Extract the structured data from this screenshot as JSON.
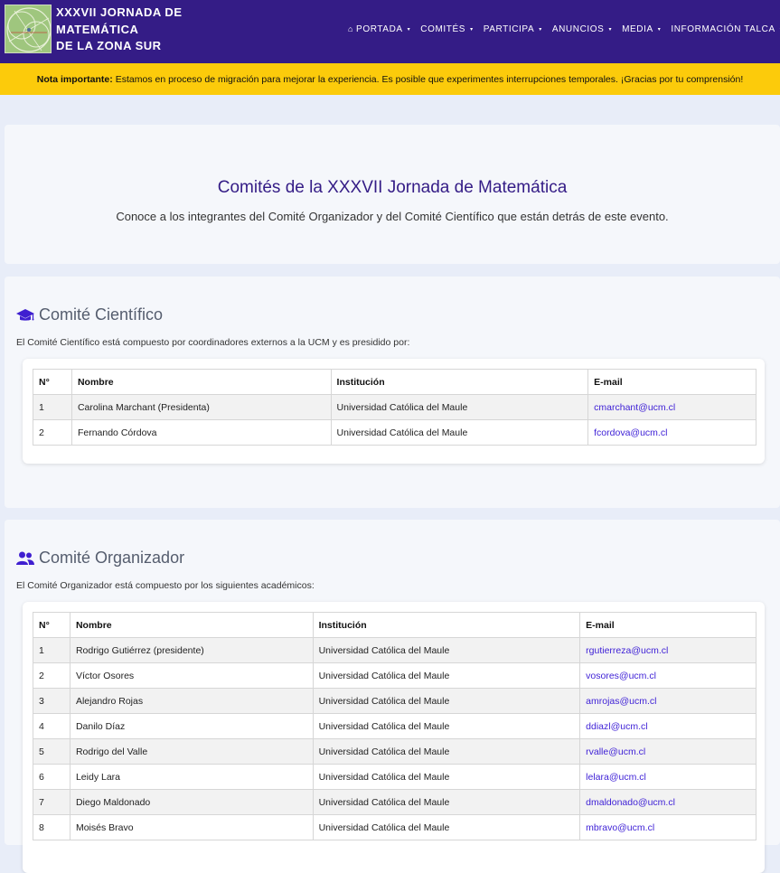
{
  "header": {
    "brand_line1": "XXXVII JORNADA DE",
    "brand_line2": "MATEMÁTICA",
    "brand_line3": "DE LA ZONA SUR",
    "nav": [
      "PORTADA",
      "COMITÉS",
      "PARTICIPA",
      "ANUNCIOS",
      "MEDIA",
      "INFORMACIÓN TALCA"
    ]
  },
  "notice": {
    "label": "Nota importante:",
    "text": "Estamos en proceso de migración para mejorar la experiencia. Es posible que experimentes interrupciones temporales. ¡Gracias por tu comprensión!"
  },
  "hero": {
    "title": "Comités de la XXXVII Jornada de Matemática",
    "subtitle": "Conoce a los integrantes del Comité Organizador y del Comité Científico que están detrás de este evento."
  },
  "cientifico": {
    "title": "Comité Científico",
    "description": "El Comité Científico está compuesto por coordinadores externos a la UCM y es presidido por:",
    "headers": [
      "N°",
      "Nombre",
      "Institución",
      "E-mail"
    ],
    "rows": [
      [
        "1",
        "Carolina Marchant (Presidenta)",
        "Universidad Católica del Maule",
        "cmarchant@ucm.cl"
      ],
      [
        "2",
        "Fernando Córdova",
        "Universidad Católica del Maule",
        "fcordova@ucm.cl"
      ]
    ]
  },
  "organizador": {
    "title": "Comité Organizador",
    "description": "El Comité Organizador está compuesto por los siguientes académicos:",
    "headers": [
      "N°",
      "Nombre",
      "Institución",
      "E-mail"
    ],
    "rows": [
      [
        "1",
        "Rodrigo Gutiérrez (presidente)",
        "Universidad Católica del Maule",
        "rgutierreza@ucm.cl"
      ],
      [
        "2",
        "Víctor Osores",
        "Universidad Católica del Maule",
        "vosores@ucm.cl"
      ],
      [
        "3",
        "Alejandro Rojas",
        "Universidad Católica del Maule",
        "amrojas@ucm.cl"
      ],
      [
        "4",
        "Danilo Díaz",
        "Universidad Católica del Maule",
        "ddiazl@ucm.cl"
      ],
      [
        "5",
        "Rodrigo del Valle",
        "Universidad Católica del Maule",
        "rvalle@ucm.cl"
      ],
      [
        "6",
        "Leidy Lara",
        "Universidad Católica del Maule",
        "lelara@ucm.cl"
      ],
      [
        "7",
        "Diego Maldonado",
        "Universidad Católica del Maule",
        "dmaldonado@ucm.cl"
      ],
      [
        "8",
        "Moisés Bravo",
        "Universidad Católica del Maule",
        "mbravo@ucm.cl"
      ]
    ]
  },
  "colors": {
    "navbar": "#341c86",
    "notice": "#fccb0b",
    "link": "#3d1fd6",
    "icon": "#3f1fd0"
  }
}
